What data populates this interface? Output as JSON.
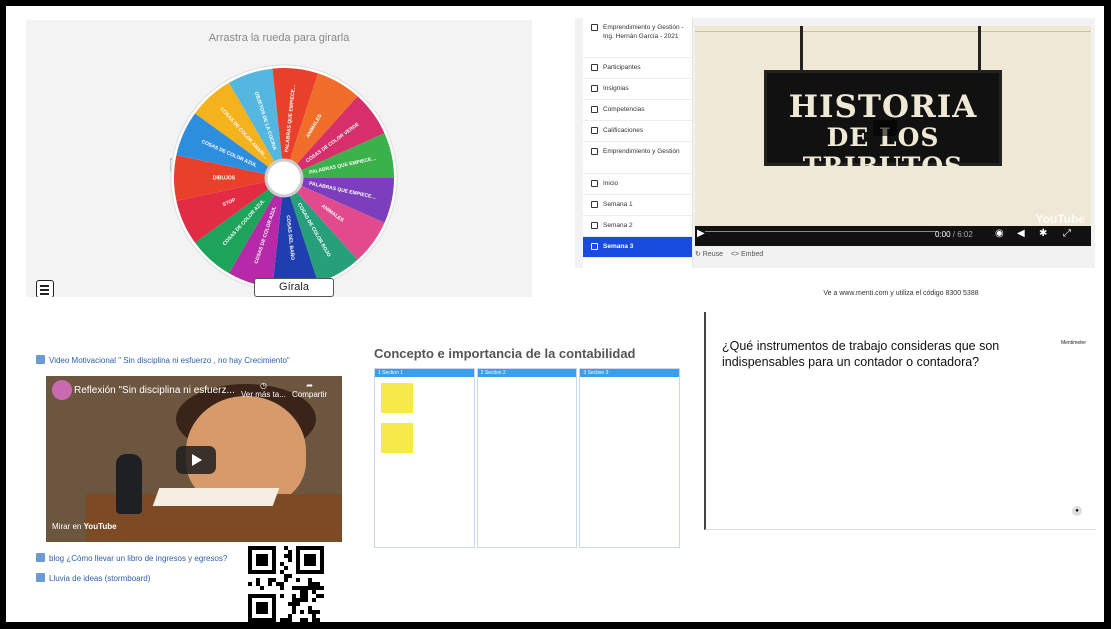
{
  "wheel": {
    "title": "Arrastra la rueda para girarla",
    "spin_label": "Gírala",
    "segments": [
      {
        "label": "DIBUJOS",
        "color": "#e8402a"
      },
      {
        "label": "COSAS DE COLOR AZUL",
        "color": "#2e8ede"
      },
      {
        "label": "COSAS DE COLOR AMARILLO",
        "color": "#f4b21c"
      },
      {
        "label": "OBJETOS DE LA COCINA",
        "color": "#54b7e0"
      },
      {
        "label": "PALABRAS QUE EMPIECEN POR LA LETRA P",
        "color": "#e8402a"
      },
      {
        "label": "ANIMALES",
        "color": "#f16e2a"
      },
      {
        "label": "COSAS DE COLOR VERDE",
        "color": "#d62f6b"
      },
      {
        "label": "PALABRAS QUE EMPIECEN POR LA LETRA S",
        "color": "#3ab14a"
      },
      {
        "label": "PALABRAS QUE EMPIECEN POR LA LETRA M",
        "color": "#7c3ebd"
      },
      {
        "label": "ANIMALES",
        "color": "#e14b8e"
      },
      {
        "label": "COSAS DE COLOR ROJO",
        "color": "#27a07a"
      },
      {
        "label": "COSAS DEL BAÑO",
        "color": "#1f3fae"
      },
      {
        "label": "COSAS DE COLOR AZUL",
        "color": "#b629a8"
      },
      {
        "label": "COSAS DE COLOR AZUL",
        "color": "#1ea45a"
      },
      {
        "label": "STOP",
        "color": "#e12c44"
      }
    ]
  },
  "course": {
    "sidebar": [
      {
        "label": "Emprendimiento y Gestión - Ing. Hernán García - 2021",
        "icon": "graduation-cap-icon"
      },
      {
        "label": "Participantes",
        "icon": "users-icon"
      },
      {
        "label": "Insignias",
        "icon": "shield-icon"
      },
      {
        "label": "Competencias",
        "icon": "checkbox-icon"
      },
      {
        "label": "Calificaciones",
        "icon": "grid-icon"
      },
      {
        "label": "Emprendimiento y Gestión",
        "icon": "folder-icon"
      },
      {
        "label": "Inicio",
        "icon": "folder-icon"
      },
      {
        "label": "Semana 1",
        "icon": "folder-icon"
      },
      {
        "label": "Semana 2",
        "icon": "folder-icon"
      },
      {
        "label": "Semana 3",
        "icon": "folder-icon"
      }
    ],
    "video": {
      "sign_line1": "HISTORIA",
      "sign_line2": "DE LOS TRIBUTOS",
      "time_current": "0:00",
      "time_total": " / 6:02",
      "watermark": "YouTube"
    },
    "reuse_label": "↻ Reuse",
    "embed_label": "<> Embed"
  },
  "resources": {
    "video_link": "Video Motivacional \" Sin disciplina ni esfuerzo , no hay Crecimiento\"",
    "video_title": "Reflexión \"Sin disciplina ni esfuerz...",
    "watch_later": "Ver más ta...",
    "share": "Compartir",
    "watch_on": "Mirar en ",
    "watch_on_brand": "YouTube",
    "blog_link": "blog ¿Cómo llevar un libro de ingresos y egresos?",
    "storm_link": "Lluvia de ideas (stormboard)"
  },
  "board": {
    "title": "Concepto e importancia de la contabilidad",
    "columns": [
      "1  Section 1",
      "2  Section 2",
      "3  Section 3"
    ]
  },
  "menti": {
    "code_text": "Ve a www.menti.com y utiliza el código 8300 5388",
    "question": "¿Qué instrumentos de trabajo consideras que son indispensables para un contador o contadora?",
    "logo": "Mentimeter"
  }
}
